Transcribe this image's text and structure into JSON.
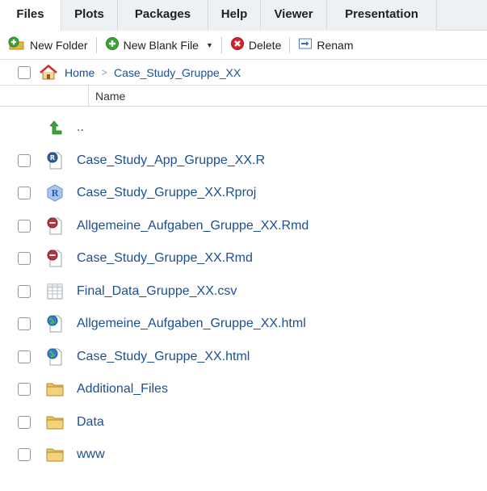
{
  "tabs": [
    {
      "label": "Files",
      "active": true
    },
    {
      "label": "Plots",
      "active": false
    },
    {
      "label": "Packages",
      "active": false
    },
    {
      "label": "Help",
      "active": false
    },
    {
      "label": "Viewer",
      "active": false
    },
    {
      "label": "Presentation",
      "active": false
    }
  ],
  "toolbar": {
    "new_folder": "New Folder",
    "new_blank_file": "New Blank File",
    "delete": "Delete",
    "rename": "Renam"
  },
  "breadcrumb": {
    "home": "Home",
    "separator": ">",
    "current": "Case_Study_Gruppe_XX"
  },
  "header": {
    "name_col": "Name"
  },
  "parent": {
    "label": ".."
  },
  "files": [
    {
      "name": "Case_Study_App_Gruppe_XX.R",
      "icon": "r-script-icon"
    },
    {
      "name": "Case_Study_Gruppe_XX.Rproj",
      "icon": "rproj-icon"
    },
    {
      "name": "Allgemeine_Aufgaben_Gruppe_XX.Rmd",
      "icon": "rmarkdown-icon"
    },
    {
      "name": "Case_Study_Gruppe_XX.Rmd",
      "icon": "rmarkdown-icon"
    },
    {
      "name": "Final_Data_Gruppe_XX.csv",
      "icon": "csv-icon"
    },
    {
      "name": "Allgemeine_Aufgaben_Gruppe_XX.html",
      "icon": "html-icon"
    },
    {
      "name": "Case_Study_Gruppe_XX.html",
      "icon": "html-icon"
    },
    {
      "name": "Additional_Files",
      "icon": "folder-icon"
    },
    {
      "name": "Data",
      "icon": "folder-icon"
    },
    {
      "name": "www",
      "icon": "folder-icon"
    }
  ],
  "colors": {
    "link": "#1d4f91",
    "border": "#d6dbe0",
    "tab_inactive_bg": "#eef1f4"
  }
}
